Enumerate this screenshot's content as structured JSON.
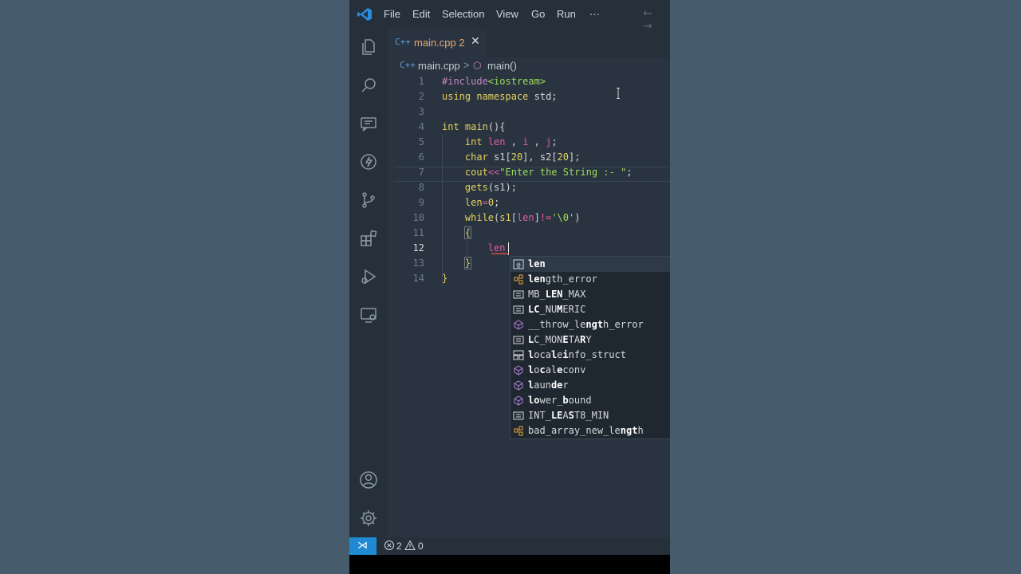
{
  "titlebar": {
    "menus": [
      "File",
      "Edit",
      "Selection",
      "View",
      "Go",
      "Run",
      "···"
    ],
    "nav": "← →"
  },
  "activity_icons": [
    "explorer-icon",
    "search-icon",
    "chat-icon",
    "lightning-icon",
    "source-control-icon",
    "extensions-icon",
    "run-debug-icon",
    "remote-explorer-icon",
    "account-icon",
    "gear-icon"
  ],
  "tab": {
    "icon": "C++",
    "label": "main.cpp 2",
    "close": "✕"
  },
  "breadcrumb": {
    "icon": "C++",
    "file": "main.cpp",
    "separator": ">",
    "fn_icon": "⬡",
    "fn": "main()"
  },
  "code": {
    "lines": [
      {
        "n": "1",
        "text": "#include<iostream>"
      },
      {
        "n": "2",
        "text": "using namespace std;"
      },
      {
        "n": "3",
        "text": ""
      },
      {
        "n": "4",
        "text": "int main(){"
      },
      {
        "n": "5",
        "text": "    int len , i , j;"
      },
      {
        "n": "6",
        "text": "    char s1[20], s2[20];"
      },
      {
        "n": "7",
        "text": "    cout<<\"Enter the String :- \";"
      },
      {
        "n": "8",
        "text": "    gets(s1);"
      },
      {
        "n": "9",
        "text": "    len=0;"
      },
      {
        "n": "10",
        "text": "    while(s1[len]!='\\0')"
      },
      {
        "n": "11",
        "text": "    {"
      },
      {
        "n": "12",
        "text": "        len"
      },
      {
        "n": "13",
        "text": "    }"
      },
      {
        "n": "14",
        "text": "}"
      }
    ],
    "active_line": "12"
  },
  "suggest": [
    {
      "kind": "variable",
      "label": "len"
    },
    {
      "kind": "class",
      "label": "length_error"
    },
    {
      "kind": "constant",
      "label": "MB_LEN_MAX"
    },
    {
      "kind": "constant",
      "label": "LC_NUMERIC"
    },
    {
      "kind": "function",
      "label": "__throw_length_error"
    },
    {
      "kind": "constant",
      "label": "LC_MONETARY"
    },
    {
      "kind": "struct",
      "label": "localeinfo_struct"
    },
    {
      "kind": "function",
      "label": "localeconv"
    },
    {
      "kind": "function",
      "label": "launder"
    },
    {
      "kind": "function",
      "label": "lower_bound"
    },
    {
      "kind": "constant",
      "label": "INT_LEAST8_MIN"
    },
    {
      "kind": "class",
      "label": "bad_array_new_length"
    }
  ],
  "status": {
    "remote_icon": "⋊",
    "errors": "2",
    "warnings": "0"
  },
  "colors": {
    "accent": "#1f8ad2",
    "background": "#2a3440",
    "tab_modified": "#e8a874"
  }
}
